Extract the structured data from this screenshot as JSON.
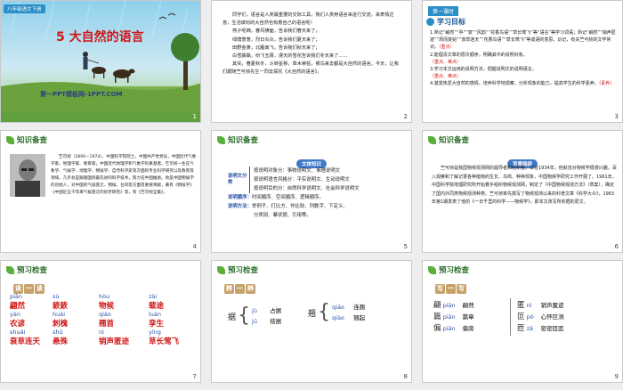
{
  "slide1": {
    "brand": "八年级语文下册",
    "title": "5 大自然的语言",
    "footer": "第一PPT模板网-1PPT.COM",
    "page": "1"
  },
  "slide2": {
    "paragraphs": [
      "同学们，语言是人类最重要的交际工具，我们人类用语言来进行交流，来表情达意，生活缤纷的大自然也有着自己的语言呢！",
      "燕子呢喃，春风拂面，告诉我们春天来了；",
      "绿荫葱葱，烈日炎炎，告诉我们夏天来了；",
      "田野金黄，北雁南飞，告诉我们秋天来了；",
      "白雪飘飘，纷飞玉屑，漫天的雪花告诉我们冬天来了……",
      "其实，春夏秋冬，斗转星移，草木荣枯，候鸟来去都是大自然的语言。今天，让我们跟随竺可桢先生一同去探究《大自然的语言》。"
    ],
    "page": "2"
  },
  "slide3": {
    "badge": "第一课时",
    "heading": "学习目标",
    "items": [
      {
        "text": "1.熟记“翩然”“孕”“衰”“风韵”“花香鸟语”“草长莺飞”等“语言”等学习词语；熟记“翩然”“销声匿迹”“周而复始”“衰草连天”“花香鸟语”“草长莺飞”等成语的意思，识记，有关竺可桢的文学常识。",
        "tag": "（重点）"
      },
      {
        "text": "2.能理清文章的层次顺序，明确其中的说明对象。",
        "tag": "（重点、难点）"
      },
      {
        "text": "3.学习本文运用的说明方法，把握说明文的说明语言。",
        "tag": "（重点、难点）"
      },
      {
        "text": "4.激发热爱大自然的感情，培养科学地观察，分析现象的能力，提高学生的科学素养。",
        "tag": "（素养）"
      }
    ],
    "page": "3"
  },
  "slide4": {
    "heading": "知识备查",
    "bio": "竺可桢（1890—1974），中国科学院院士，中国共产党党员，中国近代气象学家、地理学家、教育家，中国近代地理学和气象学的奠基者。竺可桢一生在气象学、气候学、地理学、物候学、自然科学史等方面的专业科学研究以及教育等领域，几乎总是跟随国际最先进的科学技术，努力在中国推进。他是中国物候学的创始人，对中国的气候变迁、物候、台风等方面有重要贡献，著有《物候学》《中国近五千年来气候变迁的初步研究》等，有《竺可桢全集》。",
    "page": "4"
  },
  "slide5": {
    "heading": "知识备查",
    "box_title": "文体知识",
    "groups": [
      {
        "label": "说明文分类",
        "rows": [
          "按说明对象分：事物说明文、事理说明文",
          "按说明语言风格分：平实说明文、生动说明文",
          "按说明目的分：自然科学说明文、社会科学说明文"
        ]
      },
      {
        "label": "说明顺序：",
        "rows": [
          "时间顺序、空间顺序、逻辑顺序。"
        ]
      },
      {
        "label": "说明方法：",
        "rows": [
          "举例子、打比方、作比较、列数字、下定义、",
          "分类别、摹状貌、引用等。"
        ]
      }
    ],
    "page": "5"
  },
  "slide6": {
    "heading": "知识备查",
    "box_title": "背景链接",
    "body": "竺可桢是我国物候观测网的倡导者和组织者。早在1934年，他就曾对物候学很感兴趣，深入观察和了解记录各种植物的生长、鸟鸣、种种现象，中国物候学研究工作开展了。1961年，中国科学院地理研究所开始着手组织物候观测网，制定了《中国物候观测方法》（草案），确定了国内外同类物候观测种类。竺可桢率先撰写了物候观测以来的科普文章《科学大众》，1963年第1期发表了他的《一日千里的科学——物候学》，即本文改写所依据的原文。",
    "page": "6"
  },
  "slide7": {
    "heading": "预习检查",
    "tiles": [
      "读",
      "一",
      "读"
    ],
    "rows": [
      [
        {
          "py": "piān",
          "hz": "翩然"
        },
        {
          "py": "sù",
          "hz": "簌簌"
        },
        {
          "py": "hòu",
          "hz": "物候"
        },
        {
          "py": "zài",
          "hz": "载途"
        }
      ],
      [
        {
          "py": "yàn",
          "hz": "农谚"
        },
        {
          "py": "huái",
          "hz": "刺槐"
        },
        {
          "py": "qiáo",
          "hz": "翘首"
        },
        {
          "py": "luán",
          "hz": "孪生"
        }
      ],
      [
        {
          "py": "shuāi",
          "hz": "衰草连天"
        },
        {
          "py": "shū",
          "hz": "悬殊"
        },
        {
          "py": "nì",
          "hz": "销声匿迹"
        },
        {
          "py": "yīng",
          "hz": "草长莺飞"
        }
      ]
    ],
    "page": "7"
  },
  "slide8": {
    "heading": "预习检查",
    "tiles": [
      "辨",
      "一",
      "辨"
    ],
    "left_char": "据",
    "left": [
      {
        "py": "jù",
        "hz": "占据"
      },
      {
        "py": "jū",
        "hz": "拮据"
      }
    ],
    "right_char": "翘",
    "right": [
      {
        "py": "qiáo",
        "hz": "连翘"
      },
      {
        "py": "qiào",
        "hz": "翘起"
      }
    ],
    "page": "8"
  },
  "slide9": {
    "heading": "预习检查",
    "tiles": [
      "写",
      "一",
      "写"
    ],
    "left": [
      {
        "c": "翩",
        "py": "piān",
        "w": "翩然"
      },
      {
        "c": "篇",
        "py": "piān",
        "w": "篇章"
      },
      {
        "c": "偏",
        "py": "piān",
        "w": "偏旁"
      }
    ],
    "right": [
      {
        "c": "匿",
        "py": "nì",
        "w": "销声匿迹"
      },
      {
        "c": "叵",
        "py": "pǒ",
        "w": "心怀叵测"
      },
      {
        "c": "匝",
        "py": "zā",
        "w": "密密匝匝"
      }
    ],
    "page": "9"
  },
  "colors": {
    "accent_red": "#d01818",
    "pill_blue": "#3f78c8",
    "tile": "#c7a16a",
    "section_green": "#2a6e2a"
  }
}
